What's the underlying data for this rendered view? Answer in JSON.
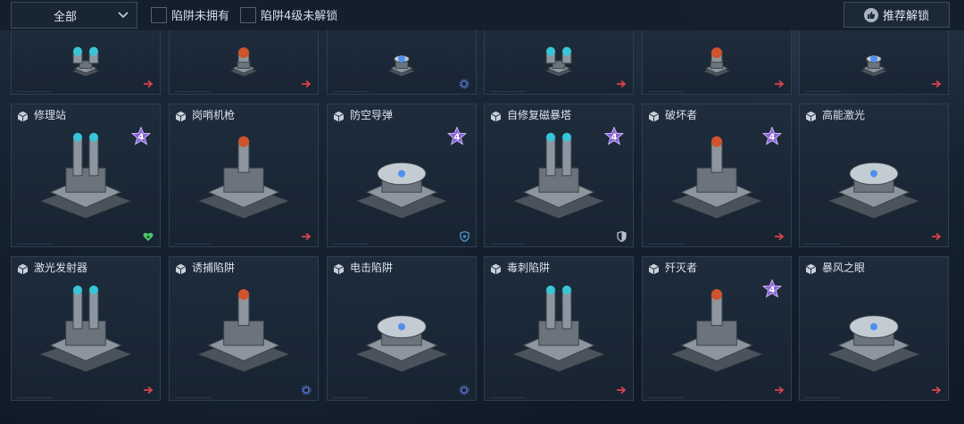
{
  "filter": {
    "dropdown_value": "全部",
    "checkbox_not_owned": "陷阱未拥有",
    "checkbox_lv4_locked": "陷阱4级未解锁",
    "recommend_button": "推荐解锁"
  },
  "colors": {
    "accent_red": "#d8434a",
    "accent_green": "#49c46a",
    "accent_blue": "#5a78d8",
    "badge_purple": "#7a55c8"
  },
  "tier_badge_text": "4",
  "rows": [
    {
      "cards": [
        {
          "name": "",
          "corner": "arrow-right-icon",
          "badge": false
        },
        {
          "name": "",
          "corner": "arrow-right-icon",
          "badge": false
        },
        {
          "name": "",
          "corner": "gear-icon",
          "badge": false
        },
        {
          "name": "",
          "corner": "arrow-right-icon",
          "badge": false
        },
        {
          "name": "",
          "corner": "arrow-right-icon",
          "badge": false
        },
        {
          "name": "",
          "corner": "arrow-right-icon",
          "badge": false
        }
      ]
    },
    {
      "cards": [
        {
          "name": "修理站",
          "corner": "heart-icon",
          "badge": true
        },
        {
          "name": "岗哨机枪",
          "corner": "arrow-right-icon",
          "badge": false
        },
        {
          "name": "防空导弹",
          "corner": "shield-icon",
          "badge": true
        },
        {
          "name": "自修复磁暴塔",
          "corner": "half-shield-icon",
          "badge": true
        },
        {
          "name": "破坏者",
          "corner": "arrow-right-icon",
          "badge": true
        },
        {
          "name": "高能激光",
          "corner": "arrow-right-icon",
          "badge": false
        }
      ]
    },
    {
      "cards": [
        {
          "name": "激光发射器",
          "corner": "arrow-right-icon",
          "badge": false
        },
        {
          "name": "诱捕陷阱",
          "corner": "gear-icon",
          "badge": false
        },
        {
          "name": "电击陷阱",
          "corner": "gear-icon",
          "badge": false
        },
        {
          "name": "毒刺陷阱",
          "corner": "arrow-right-icon",
          "badge": false
        },
        {
          "name": "歼灭者",
          "corner": "arrow-right-icon",
          "badge": true
        },
        {
          "name": "暴风之眼",
          "corner": "arrow-right-icon",
          "badge": false
        }
      ]
    }
  ]
}
